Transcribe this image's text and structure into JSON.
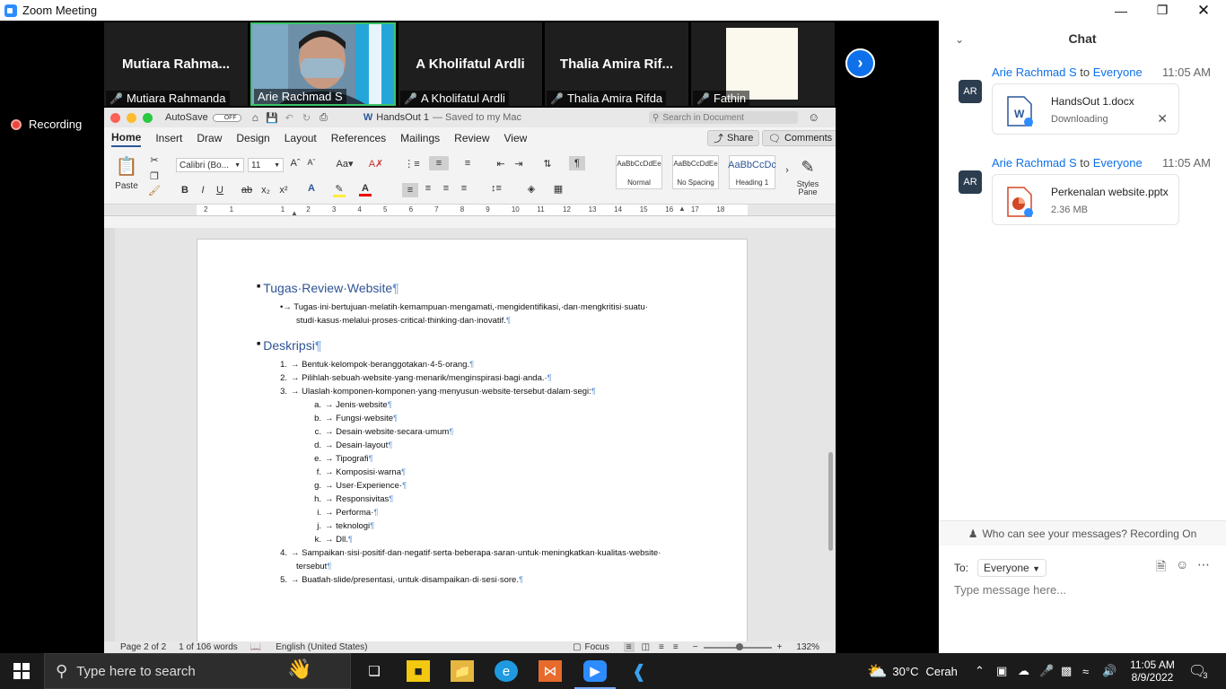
{
  "window": {
    "title": "Zoom Meeting",
    "min_icon": "minimize-icon",
    "max_icon": "restore-icon",
    "close_icon": "close-icon"
  },
  "participants": [
    {
      "big_name": "Mutiara  Rahma...",
      "label": "Mutiara Rahmanda",
      "muted": true
    },
    {
      "big_name": "",
      "label": "Arie Rachmad S",
      "muted": false,
      "video": true
    },
    {
      "big_name": "A Kholifatul Ardli",
      "label": "A Kholifatul Ardli",
      "muted": true
    },
    {
      "big_name": "Thalia Amira Rif...",
      "label": "Thalia Amira Rifda",
      "muted": true
    },
    {
      "big_name": "",
      "label": "Fathin",
      "muted": true
    }
  ],
  "recording": "Recording",
  "word": {
    "autosave": "AutoSave",
    "autosave_state": "OFF",
    "doc_title": "HandsOut 1",
    "saved": "— Saved to my Mac",
    "search_placeholder": "Search in Document",
    "tabs": [
      "Home",
      "Insert",
      "Draw",
      "Design",
      "Layout",
      "References",
      "Mailings",
      "Review",
      "View"
    ],
    "share": "Share",
    "comments": "Comments",
    "paste": "Paste",
    "font": "Calibri (Bo...",
    "size": "11",
    "styles": [
      {
        "preview": "AaBbCcDdEe",
        "name": "Normal"
      },
      {
        "preview": "AaBbCcDdEe",
        "name": "No Spacing"
      },
      {
        "preview": "AaBbCcDc",
        "name": "Heading 1"
      }
    ],
    "styles_pane": "Styles Pane",
    "ruler_ticks": [
      "2",
      "1",
      "",
      "1",
      "2",
      "3",
      "4",
      "5",
      "6",
      "7",
      "8",
      "9",
      "10",
      "11",
      "12",
      "13",
      "14",
      "15",
      "16",
      "17",
      "18"
    ],
    "heading1": "Tugas·Review·Website",
    "bullet1": "Tugas·ini·bertujuan·melatih·kemampuan·mengamati,·mengidentifikasi,·dan·mengkritisi·suatu·",
    "bullet1b": "studi·kasus·melalui·proses·critical·thinking·dan·inovatif.",
    "heading2": "Deskripsi",
    "items": [
      {
        "n": "1.",
        "t": "Bentuk·kelompok·beranggotakan·4-5·orang."
      },
      {
        "n": "2.",
        "t": "Pilihlah·sebuah·website·yang·menarik/menginspirasi·bagi·anda.·"
      },
      {
        "n": "3.",
        "t": "Ulaslah·komponen-komponen·yang·menyusun·website·tersebut·dalam·segi:"
      }
    ],
    "subitems": [
      {
        "n": "a.",
        "t": "Jenis·website"
      },
      {
        "n": "b.",
        "t": "Fungsi·website"
      },
      {
        "n": "c.",
        "t": "Desain·website·secara·umum"
      },
      {
        "n": "d.",
        "t": "Desain·layout"
      },
      {
        "n": "e.",
        "t": "Tipografi"
      },
      {
        "n": "f.",
        "t": "Komposisi·warna"
      },
      {
        "n": "g.",
        "t": "User·Experience·"
      },
      {
        "n": "h.",
        "t": "Responsivitas"
      },
      {
        "n": "i.",
        "t": "Performa·"
      },
      {
        "n": "j.",
        "t": "teknologi"
      },
      {
        "n": "k.",
        "t": "Dll."
      }
    ],
    "item4": {
      "n": "4.",
      "t": "Sampaikan·sisi·positif·dan·negatif·serta·beberapa·saran·untuk·meningkatkan·kualitas·website·",
      "t2": "tersebut"
    },
    "item5": {
      "n": "5.",
      "t": "Buatlah·slide/presentasi,·untuk·disampaikan·di·sesi·sore."
    },
    "status": {
      "page": "Page 2 of 2",
      "words": "1 of 106 words",
      "lang": "English (United States)",
      "focus": "Focus",
      "zoom": "132%"
    }
  },
  "chat": {
    "title": "Chat",
    "messages": [
      {
        "avatar": "AR",
        "sender": "Arie Rachmad S",
        "to": "to",
        "recipient": "Everyone",
        "time": "11:05 AM",
        "file": "HandsOut 1.docx",
        "sub": "Downloading",
        "type": "word"
      },
      {
        "avatar": "AR",
        "sender": "Arie Rachmad S",
        "to": "to",
        "recipient": "Everyone",
        "time": "11:05 AM",
        "file": "Perkenalan website.pptx",
        "sub": "2.36 MB",
        "type": "ppt"
      }
    ],
    "who_can_see": "Who can see your messages? Recording On",
    "to_label": "To:",
    "to_value": "Everyone",
    "input_placeholder": "Type message here..."
  },
  "taskbar": {
    "search_placeholder": "Type here to search",
    "temp": "30°C",
    "weather": "Cerah",
    "time": "11:05 AM",
    "date": "8/9/2022",
    "notifications": "3"
  }
}
